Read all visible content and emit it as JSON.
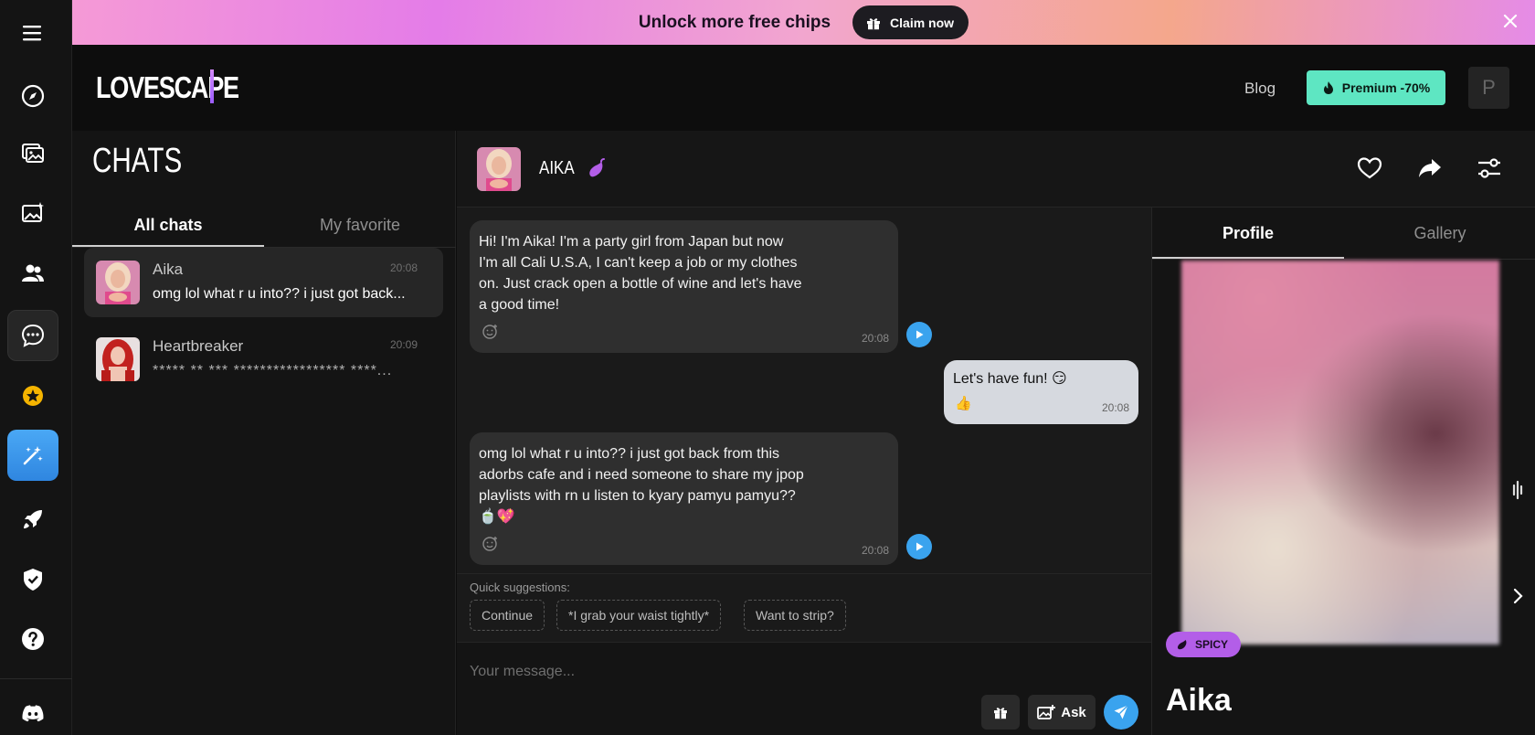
{
  "banner": {
    "text": "Unlock more free chips",
    "claim_label": "Claim now"
  },
  "header": {
    "logo": "LOVESCAPE",
    "blog": "Blog",
    "premium": "Premium -70%",
    "avatar_initial": "P"
  },
  "rail": {
    "items": [
      "explore-icon",
      "gallery-icon",
      "image-create-icon",
      "characters-icon",
      "chats-icon",
      "favorites-icon",
      "magic-icon",
      "rocket-icon",
      "shield-icon",
      "help-icon",
      "discord-icon"
    ]
  },
  "chats": {
    "title": "CHATS",
    "tabs": [
      "All chats",
      "My favorite"
    ],
    "items": [
      {
        "name": "Aika",
        "time": "20:08",
        "preview": "omg lol what r u into?? i just got back..."
      },
      {
        "name": "Heartbreaker",
        "time": "20:09",
        "preview": "***** ** *** ***************** ****..."
      }
    ]
  },
  "conversation": {
    "name": "AIKA",
    "messages": [
      {
        "from": "bot",
        "text": "Hi! I'm Aika! I'm a party girl from Japan but now\nI'm all Cali U.S.A, I can't keep a job or my clothes\non. Just crack open a bottle of wine and let's have\na good time!",
        "time": "20:08"
      },
      {
        "from": "user",
        "text": "Let's have fun! 😏",
        "reaction": "👍",
        "time": "20:08"
      },
      {
        "from": "bot",
        "text": "omg lol what r u into?? i just got back from this\nadorbs cafe and i need someone to share my jpop\nplaylists with rn u listen to kyary pamyu pamyu??\n🍵💖",
        "time": "20:08"
      }
    ],
    "suggestions_label": "Quick suggestions:",
    "suggestions": [
      "Continue",
      "*I grab your waist tightly*",
      "Want to strip?"
    ],
    "input_placeholder": "Your message...",
    "ask_label": "Ask"
  },
  "profile": {
    "tabs": [
      "Profile",
      "Gallery"
    ],
    "badge": "SPICY",
    "name": "Aika"
  },
  "colors": {
    "accent_blue": "#3aa3ee",
    "premium": "#5ee6c2",
    "spicy": "#b35ee8"
  }
}
